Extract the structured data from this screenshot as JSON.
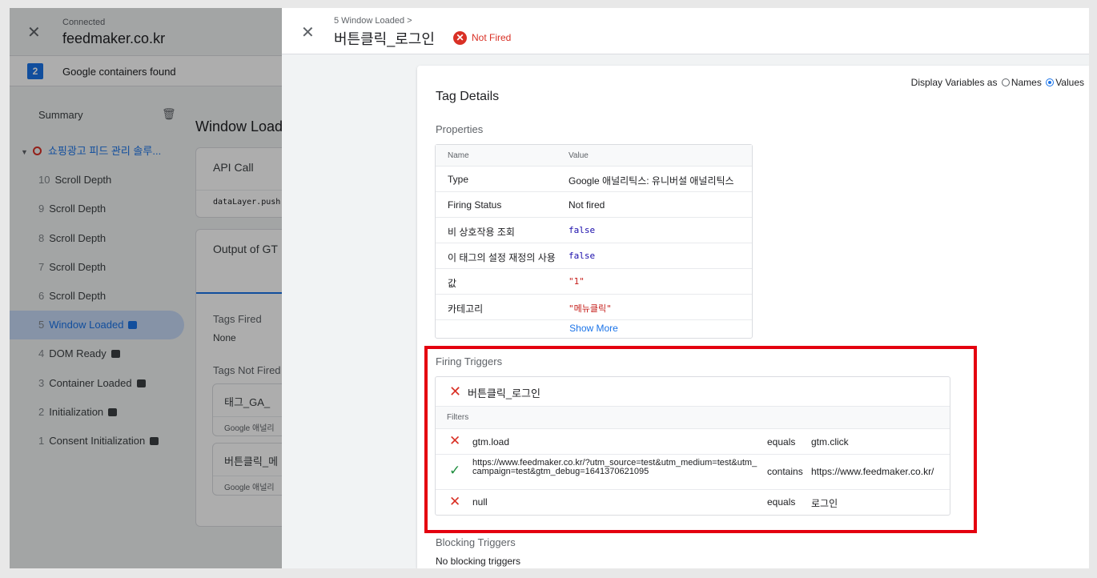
{
  "left": {
    "connected_label": "Connected",
    "domain": "feedmaker.co.kr",
    "containers_count": "2",
    "containers_label": "Google containers found",
    "summary_label": "Summary",
    "page_item": "쇼핑광고 피드 관리 솔루...",
    "events": [
      {
        "num": "10",
        "label": "Scroll Depth"
      },
      {
        "num": "9",
        "label": "Scroll Depth"
      },
      {
        "num": "8",
        "label": "Scroll Depth"
      },
      {
        "num": "7",
        "label": "Scroll Depth"
      },
      {
        "num": "6",
        "label": "Scroll Depth"
      },
      {
        "num": "5",
        "label": "Window Loaded"
      },
      {
        "num": "4",
        "label": "DOM Ready"
      },
      {
        "num": "3",
        "label": "Container Loaded"
      },
      {
        "num": "2",
        "label": "Initialization"
      },
      {
        "num": "1",
        "label": "Consent Initialization"
      }
    ]
  },
  "middle": {
    "title": "Window Load",
    "api_call": "API Call",
    "api_code": "dataLayer.push",
    "output_label": "Output of GT",
    "tags_fired_label": "Tags Fired",
    "tags_fired_value": "None",
    "tags_not_fired_label": "Tags Not Fired",
    "tag1_name": "태그_GA_",
    "tag1_sub": "Google 애널리",
    "tag2_name": "버튼클릭_메",
    "tag2_sub": "Google 애널리"
  },
  "panel": {
    "breadcrumb": "5 Window Loaded >",
    "title": "버튼클릭_로그인",
    "status": "Not Fired",
    "display_vars_label": "Display Variables as",
    "names_label": "Names",
    "values_label": "Values",
    "tag_details": "Tag Details",
    "properties_label": "Properties",
    "properties_header": {
      "name": "Name",
      "value": "Value"
    },
    "properties": [
      {
        "name": "Type",
        "value": "Google 애널리틱스: 유니버설 애널리틱스"
      },
      {
        "name": "Firing Status",
        "value": "Not fired"
      },
      {
        "name": "비 상호작용 조회",
        "value": "false"
      },
      {
        "name": "이 태그의 설정 재정의 사용",
        "value": "false"
      },
      {
        "name": "값",
        "value": "\"1\""
      },
      {
        "name": "카테고리",
        "value": "\"메뉴클릭\""
      }
    ],
    "show_more": "Show More",
    "firing_triggers_label": "Firing Triggers",
    "trigger_name": "버튼클릭_로그인",
    "filters_label": "Filters",
    "filters": [
      {
        "value": "gtm.load",
        "op": "equals",
        "target": "gtm.click",
        "pass": false
      },
      {
        "value": "https://www.feedmaker.co.kr/?utm_source=test&utm_medium=test&utm_campaign=test&gtm_debug=1641370621095",
        "op": "contains",
        "target": "https://www.feedmaker.co.kr/",
        "pass": true
      },
      {
        "value": "null",
        "op": "equals",
        "target": "로그인",
        "pass": false
      }
    ],
    "blocking_triggers_label": "Blocking Triggers",
    "blocking_triggers_value": "No blocking triggers"
  },
  "colors": {
    "accent": "#1a73e8",
    "error": "#d93025",
    "success": "#1e8e3e",
    "highlight": "#e4000f"
  }
}
